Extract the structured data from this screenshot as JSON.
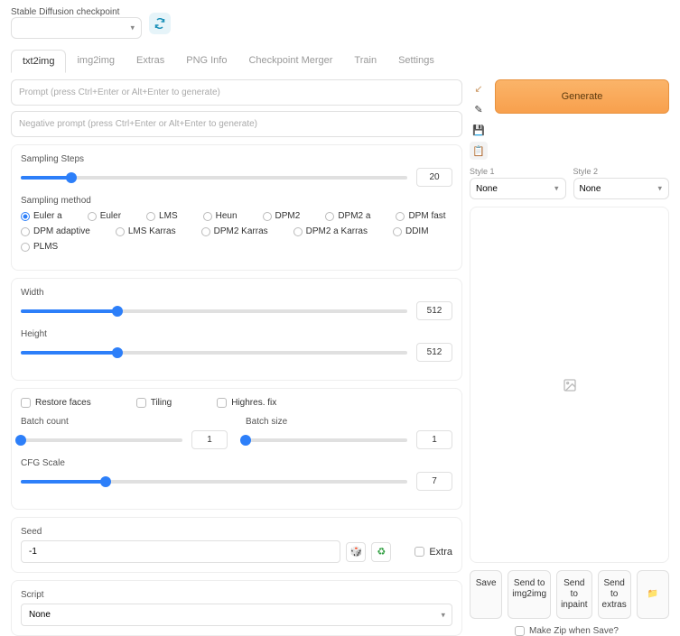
{
  "checkpoint": {
    "label": "Stable Diffusion checkpoint"
  },
  "tabs": [
    "txt2img",
    "img2img",
    "Extras",
    "PNG Info",
    "Checkpoint Merger",
    "Train",
    "Settings"
  ],
  "activeTab": 0,
  "prompt": {
    "placeholder": "Prompt (press Ctrl+Enter or Alt+Enter to generate)"
  },
  "negPrompt": {
    "placeholder": "Negative prompt (press Ctrl+Enter or Alt+Enter to generate)"
  },
  "samplingSteps": {
    "label": "Sampling Steps",
    "value": "20",
    "percent": 13
  },
  "samplingMethod": {
    "label": "Sampling method",
    "options": [
      "Euler a",
      "Euler",
      "LMS",
      "Heun",
      "DPM2",
      "DPM2 a",
      "DPM fast",
      "DPM adaptive",
      "LMS Karras",
      "DPM2 Karras",
      "DPM2 a Karras",
      "DDIM",
      "PLMS"
    ],
    "selected": "Euler a"
  },
  "width": {
    "label": "Width",
    "value": "512",
    "percent": 25
  },
  "height": {
    "label": "Height",
    "value": "512",
    "percent": 25
  },
  "checks": {
    "restore": "Restore faces",
    "tiling": "Tiling",
    "hires": "Highres. fix"
  },
  "batchCount": {
    "label": "Batch count",
    "value": "1",
    "percent": 0
  },
  "batchSize": {
    "label": "Batch size",
    "value": "1",
    "percent": 0
  },
  "cfg": {
    "label": "CFG Scale",
    "value": "7",
    "percent": 22
  },
  "seed": {
    "label": "Seed",
    "value": "-1",
    "extra": "Extra"
  },
  "script": {
    "label": "Script",
    "value": "None"
  },
  "generate": "Generate",
  "style1": {
    "label": "Style 1",
    "value": "None"
  },
  "style2": {
    "label": "Style 2",
    "value": "None"
  },
  "actions": {
    "save": "Save",
    "img2img": "Send to img2img",
    "inpaint": "Send to inpaint",
    "extras": "Send to extras"
  },
  "zip": "Make Zip when Save?"
}
